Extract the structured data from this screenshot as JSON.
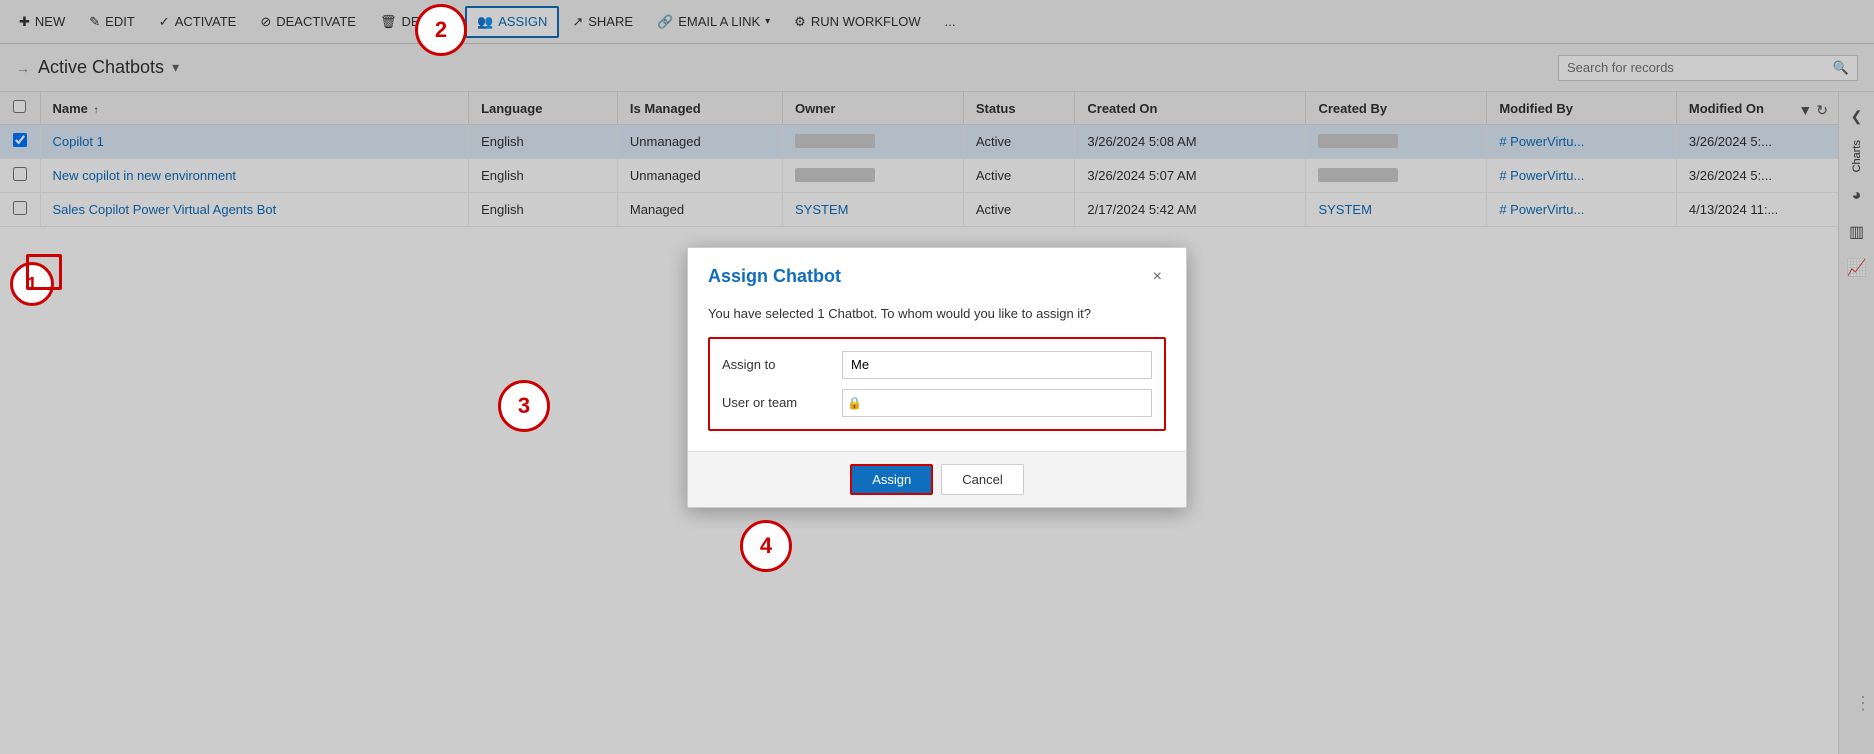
{
  "toolbar": {
    "new_label": "NEW",
    "edit_label": "EDIT",
    "activate_label": "ACTIVATE",
    "deactivate_label": "DEACTIVATE",
    "delete_label": "DELETE",
    "assign_label": "ASSIGN",
    "share_label": "SHARE",
    "email_link_label": "EMAIL A LINK",
    "run_workflow_label": "RUN WORKFLOW",
    "more_label": "..."
  },
  "breadcrumb": {
    "arrow": "→",
    "title": "Active Chatbots",
    "dropdown_icon": "▾"
  },
  "search": {
    "placeholder": "Search for records"
  },
  "table": {
    "columns": [
      "",
      "Name ↑",
      "Language",
      "Is Managed",
      "Owner",
      "Status",
      "Created On",
      "Created By",
      "Modified By",
      "Modified On"
    ],
    "rows": [
      {
        "checked": true,
        "name": "Copilot 1",
        "language": "English",
        "is_managed": "Unmanaged",
        "owner": "BLURRED",
        "status": "Active",
        "created_on": "3/26/2024 5:08 AM",
        "created_by": "BLURRED",
        "modified_by": "# PowerVirtu...",
        "modified_on": "3/26/2024 5:..."
      },
      {
        "checked": false,
        "name": "New copilot in new environment",
        "language": "English",
        "is_managed": "Unmanaged",
        "owner": "BLURRED",
        "status": "Active",
        "created_on": "3/26/2024 5:07 AM",
        "created_by": "BLURRED",
        "modified_by": "# PowerVirtu...",
        "modified_on": "3/26/2024 5:..."
      },
      {
        "checked": false,
        "name": "Sales Copilot Power Virtual Agents Bot",
        "language": "English",
        "is_managed": "Managed",
        "owner": "SYSTEM",
        "status": "Active",
        "created_on": "2/17/2024 5:42 AM",
        "created_by": "SYSTEM",
        "modified_by": "# PowerVirtu...",
        "modified_on": "4/13/2024 11:..."
      }
    ]
  },
  "modal": {
    "title": "Assign Chatbot",
    "description": "You have selected 1 Chatbot. To whom would you like to assign it?",
    "close_icon": "×",
    "assign_to_label": "Assign to",
    "assign_to_value": "Me",
    "user_or_team_label": "User or team",
    "user_or_team_placeholder": "",
    "assign_button_label": "Assign",
    "cancel_button_label": "Cancel"
  },
  "steps": {
    "step1": "1",
    "step2": "2",
    "step3": "3",
    "step4": "4"
  },
  "right_sidebar": {
    "charts_label": "Charts",
    "icon1": "⊕",
    "icon2": "◎",
    "icon3": "▥",
    "icon4": "⚬"
  }
}
